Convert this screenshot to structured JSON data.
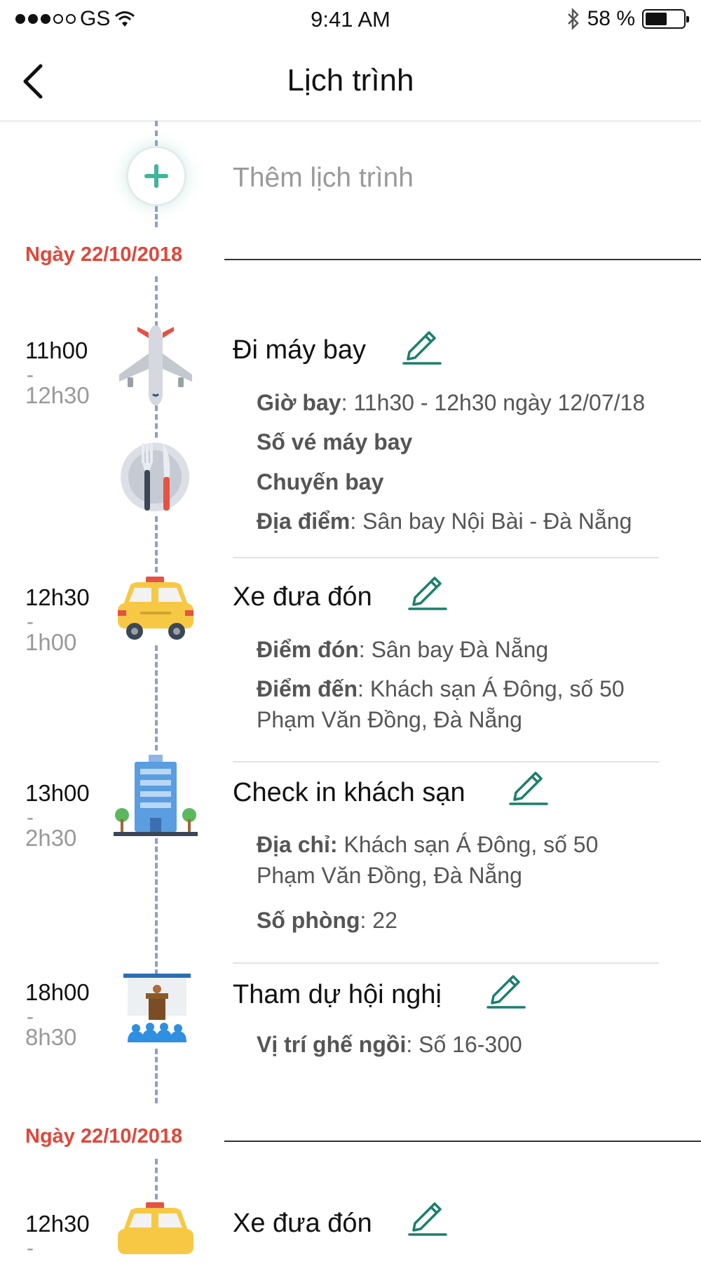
{
  "status_bar": {
    "carrier": "GS",
    "time": "9:41 AM",
    "battery_percent": "58 %",
    "battery_level": 0.58
  },
  "nav": {
    "title": "Lịch trình"
  },
  "add_schedule_label": "Thêm lịch trình",
  "days": [
    {
      "date": "Ngày 22/10/2018",
      "events": [
        {
          "start": "11h00",
          "dash": "-",
          "end": "12h30",
          "icon": "airplane-icon",
          "secondary_icon": "meal-icon",
          "title": "Đi máy bay",
          "details": [
            {
              "label": "Giờ bay",
              "sep": ": ",
              "value": "11h30 - 12h30 ngày 12/07/18"
            },
            {
              "label": "Số vé máy bay",
              "sep": "",
              "value": ""
            },
            {
              "label": "Chuyến bay",
              "sep": "",
              "value": ""
            },
            {
              "label": "Địa điểm",
              "sep": ": ",
              "value": "Sân bay Nội Bài - Đà Nẵng"
            }
          ]
        },
        {
          "start": "12h30",
          "dash": "-",
          "end": "1h00",
          "icon": "taxi-icon",
          "title": "Xe đưa đón",
          "details": [
            {
              "label": "Điểm đón",
              "sep": ": ",
              "value": "Sân bay Đà Nẵng"
            },
            {
              "label": "Điểm đến",
              "sep": ": ",
              "value": "Khách sạn Á Đông, số 50",
              "value2": "Phạm Văn Đồng, Đà Nẵng"
            }
          ]
        },
        {
          "start": "13h00",
          "dash": "-",
          "end": "2h30",
          "icon": "hotel-icon",
          "title": "Check in khách sạn",
          "details": [
            {
              "label": "Địa chỉ:",
              "sep": " ",
              "value": "Khách sạn Á Đông, số 50",
              "value2": "Phạm Văn Đồng, Đà Nẵng"
            },
            {
              "label": "Số phòng",
              "sep": ": ",
              "value": "22"
            }
          ]
        },
        {
          "start": "18h00",
          "dash": "-",
          "end": "8h30",
          "icon": "conference-icon",
          "title": "Tham dự hội nghị",
          "details": [
            {
              "label": "Vị trí ghế ngồi",
              "sep": ": ",
              "value": "Số 16-300"
            }
          ]
        }
      ]
    },
    {
      "date": "Ngày 22/10/2018",
      "events": [
        {
          "start": "12h30",
          "dash": "-",
          "icon": "taxi-icon",
          "title": "Xe đưa đón"
        }
      ]
    }
  ],
  "colors": {
    "date_red": "#e0473a",
    "edit_green": "#1b7f6c",
    "timeline_blue": "#8f9cd3",
    "add_plus_teal": "#3fb59c"
  }
}
